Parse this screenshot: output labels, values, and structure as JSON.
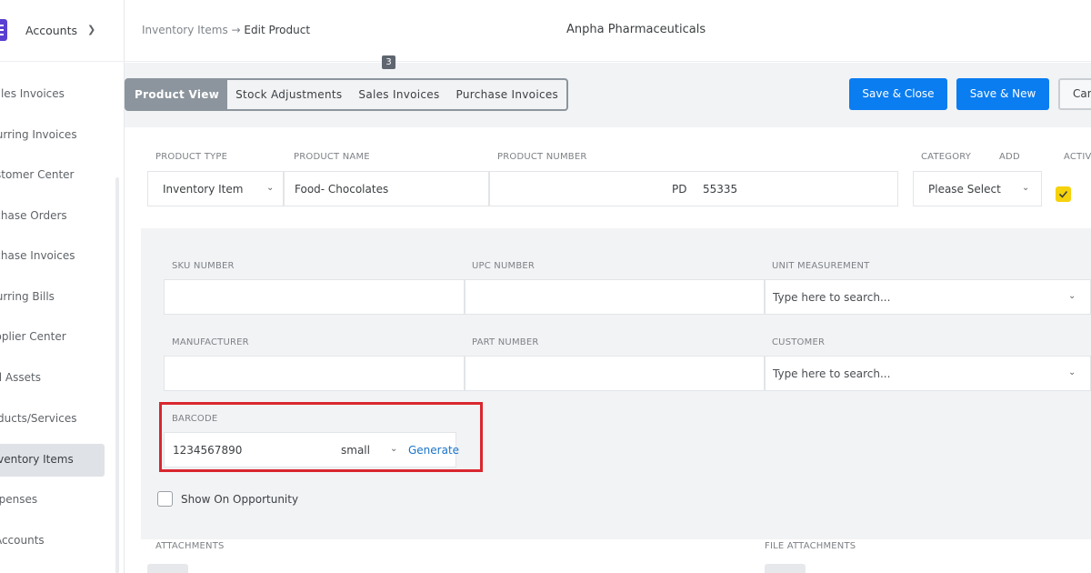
{
  "sidebar": {
    "title": "Accounts",
    "items": [
      {
        "label": "Sales Invoices"
      },
      {
        "label": "Recurring Invoices"
      },
      {
        "label": "Customer Center"
      },
      {
        "label": "Purchase Orders"
      },
      {
        "label": "Purchase Invoices"
      },
      {
        "label": "Recurring Bills"
      },
      {
        "label": "Supplier Center"
      },
      {
        "label": "Fixed Assets"
      },
      {
        "label": "Products/Services"
      },
      {
        "label": "Inventory Items"
      },
      {
        "label": "Expenses"
      },
      {
        "label": "Bank Accounts"
      }
    ]
  },
  "header": {
    "breadcrumb_parent": "Inventory Items",
    "breadcrumb_sep": "→",
    "breadcrumb_current": "Edit Product",
    "company": "Anpha Pharmaceuticals"
  },
  "tabs": [
    {
      "label": "Product View"
    },
    {
      "label": "Stock Adjustments"
    },
    {
      "label": "Sales Invoices",
      "badge": "3"
    },
    {
      "label": "Purchase Invoices"
    }
  ],
  "actions": {
    "save_close": "Save & Close",
    "save_new": "Save & New",
    "cancel": "Cancel"
  },
  "product": {
    "product_type_label": "PRODUCT TYPE",
    "product_type_value": "Inventory Item",
    "product_name_label": "PRODUCT NAME",
    "product_name_value": "Food- Chocolates",
    "product_number_label": "PRODUCT NUMBER",
    "product_number_prefix": "PD",
    "product_number_value": "55335",
    "category_label": "CATEGORY",
    "add_label": "ADD",
    "category_value": "Please Select",
    "active_label": "ACTIVE",
    "active_checked": true
  },
  "details": {
    "sku_label": "SKU NUMBER",
    "upc_label": "UPC NUMBER",
    "unit_label": "UNIT MEASUREMENT",
    "unit_placeholder": "Type here to search...",
    "manufacturer_label": "MANUFACTURER",
    "part_label": "PART NUMBER",
    "customer_label": "CUSTOMER",
    "customer_placeholder": "Type here to search...",
    "barcode_label": "BARCODE",
    "barcode_value": "1234567890",
    "barcode_size": "small",
    "generate_label": "Generate",
    "show_on_opportunity_label": "Show On Opportunity"
  },
  "attachments": {
    "attachments_label": "ATTACHMENTS",
    "file_attachments_label": "FILE ATTACHMENTS"
  },
  "colors": {
    "primary": "#0a7df0",
    "highlight": "#d9272e",
    "active_check": "#f5d20b",
    "brand": "#5a3fd1"
  }
}
